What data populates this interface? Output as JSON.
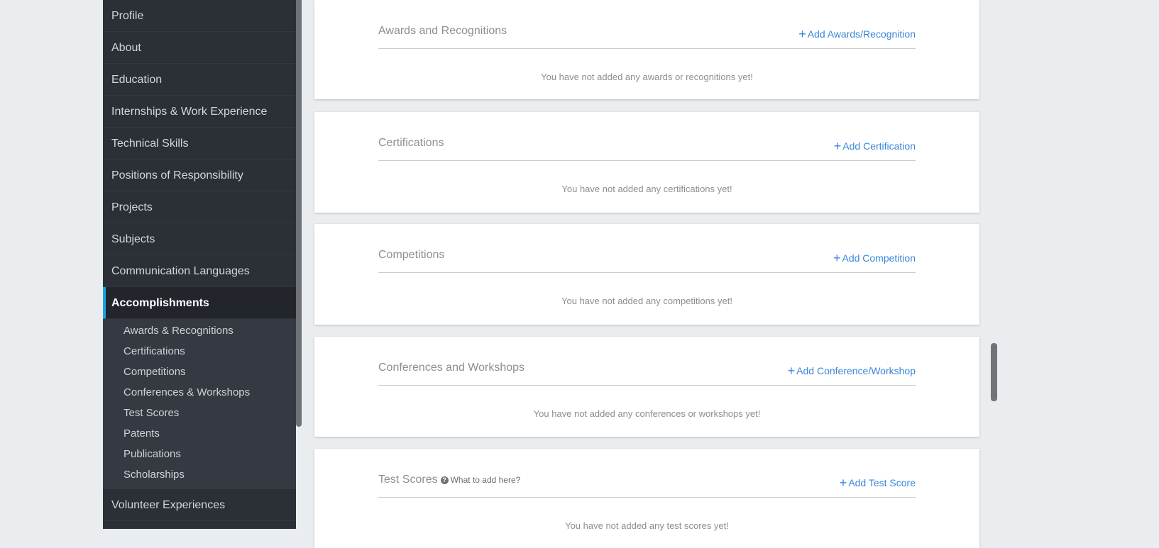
{
  "sidebar": {
    "items": [
      {
        "label": "Profile"
      },
      {
        "label": "About"
      },
      {
        "label": "Education"
      },
      {
        "label": "Internships & Work Experience"
      },
      {
        "label": "Technical Skills"
      },
      {
        "label": "Positions of Responsibility"
      },
      {
        "label": "Projects"
      },
      {
        "label": "Subjects"
      },
      {
        "label": "Communication Languages"
      }
    ],
    "active_label": "Accomplishments",
    "submenu": [
      {
        "label": "Awards & Recognitions"
      },
      {
        "label": "Certifications"
      },
      {
        "label": "Competitions"
      },
      {
        "label": "Conferences & Workshops"
      },
      {
        "label": "Test Scores"
      },
      {
        "label": "Patents"
      },
      {
        "label": "Publications"
      },
      {
        "label": "Scholarships"
      }
    ],
    "after_label": "Volunteer Experiences"
  },
  "sections": [
    {
      "title": "Awards and Recognitions",
      "add_label": "Add Awards/Recognition",
      "empty": "You have not added any awards or recognitions yet!"
    },
    {
      "title": "Certifications",
      "add_label": "Add Certification",
      "empty": "You have not added any certifications yet!"
    },
    {
      "title": "Competitions",
      "add_label": "Add Competition",
      "empty": "You have not added any competitions yet!"
    },
    {
      "title": "Conferences and Workshops",
      "add_label": "Add Conference/Workshop",
      "empty": "You have not added any conferences or workshops yet!"
    },
    {
      "title": "Test Scores",
      "help": "What to add here?",
      "add_label": "Add Test Score",
      "empty": "You have not added any test scores yet!"
    }
  ],
  "colors": {
    "accent": "#3a86d8",
    "sidebar_bg": "#2b2f36",
    "active_bar": "#1aa3e6"
  },
  "icons": {
    "add": "plus-icon",
    "help": "question-circle-icon"
  }
}
